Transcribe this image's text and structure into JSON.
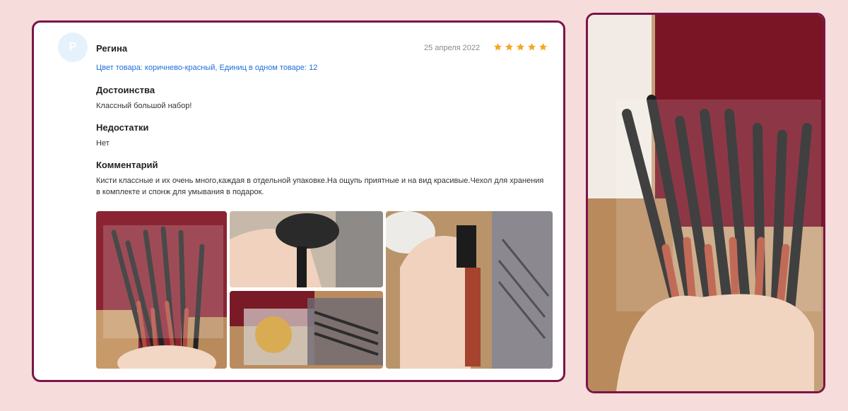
{
  "review": {
    "avatar_letter": "Р",
    "author": "Регина",
    "date": "25 апреля 2022",
    "rating": 5,
    "variant": "Цвет товара: коричнево-красный, Единиц в одном товаре: 12",
    "pros_title": "Достоинства",
    "pros_text": "Классный большой набор!",
    "cons_title": "Недостатки",
    "cons_text": "Нет",
    "comment_title": "Комментарий",
    "comment_text": "Кисти классные и их очень много,каждая в отдельной упаковке.На ощупь приятные и на вид красивые.Чехол для хранения в комплекте и спонж для умывания в подарок."
  },
  "colors": {
    "background": "#f7dcdc",
    "border": "#7a1547",
    "link": "#1e6fd9",
    "star": "#f5a623"
  }
}
